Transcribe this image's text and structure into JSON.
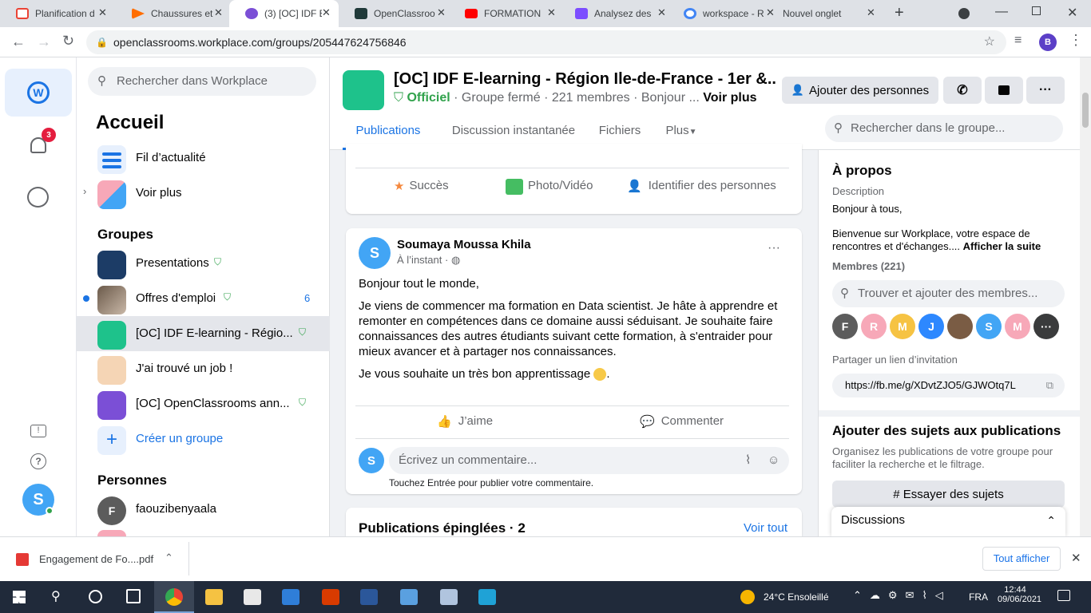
{
  "browser": {
    "tabs": [
      {
        "title": "Planification d",
        "color": "#ea4335"
      },
      {
        "title": "Chaussures et",
        "color": "#ff6d00"
      },
      {
        "title": "(3) [OC] IDF E",
        "color": "#7b4fd6"
      },
      {
        "title": "OpenClassroo",
        "color": "#203a3a"
      },
      {
        "title": "FORMATION",
        "color": "#ff0000"
      },
      {
        "title": "Analysez des",
        "color": "#7c4dff"
      },
      {
        "title": "workspace - R",
        "color": "#4285f4"
      },
      {
        "title": "Nouvel onglet",
        "color": ""
      }
    ],
    "url": "openclassrooms.workplace.com/groups/205447624756846",
    "profile_initial": "B"
  },
  "rail": {
    "notif_count": "3",
    "user_initial": "S"
  },
  "nav": {
    "search_placeholder": "Rechercher dans Workplace",
    "heading": "Accueil",
    "feed": "Fil d’actualité",
    "more": "Voir plus",
    "groups_title": "Groupes",
    "groups": [
      {
        "label": "Presentations",
        "badge": ""
      },
      {
        "label": "Offres d'emploi",
        "badge": "6"
      },
      {
        "label": "[OC] IDF E-learning - Régio...",
        "badge": ""
      },
      {
        "label": "J'ai trouvé un job !",
        "badge": ""
      },
      {
        "label": "[OC] OpenClassrooms ann...",
        "badge": ""
      }
    ],
    "create_group": "Créer un groupe",
    "people_title": "Personnes",
    "person1": "faouzibenyaala",
    "person1_initial": "F"
  },
  "group": {
    "title": "[OC] IDF E-learning - Région Ile-de-France - 1er &...",
    "official": "Officiel",
    "meta": "· Groupe fermé · 221 membres · Bonjour ...",
    "see_more": "Voir plus",
    "add_people": "Ajouter des personnes",
    "tabs": [
      "Publications",
      "Discussion instantanée",
      "Fichiers",
      "Plus"
    ],
    "search_placeholder": "Rechercher dans le groupe..."
  },
  "composer": {
    "success": "Succès",
    "photo": "Photo/Vidéo",
    "tag": "Identifier des personnes"
  },
  "post": {
    "author": "Soumaya Moussa Khila",
    "author_initial": "S",
    "time": "À l’instant ·",
    "p1": "Bonjour tout le monde,",
    "p2": "Je viens de commencer ma formation en Data scientist. Je hâte à apprendre et remonter en compétences dans ce domaine aussi séduisant. Je souhaite faire connaissances des autres étudiants suivant cette formation, à s'entraider pour mieux avancer et à partager nos connaissances.",
    "p3": "Je vous souhaite un très bon apprentissage",
    "p3_end": ".",
    "like": "J’aime",
    "comment": "Commenter",
    "comment_placeholder": "Écrivez un commentaire...",
    "hint": "Touchez Entrée pour publier votre commentaire."
  },
  "pinned": {
    "title": "Publications épinglées · 2",
    "see_all": "Voir tout"
  },
  "about": {
    "title": "À propos",
    "desc_label": "Description",
    "desc1": "Bonjour à tous,",
    "desc2": "Bienvenue sur Workplace, votre espace de rencontres et d'échanges....",
    "read_more": "Afficher la suite",
    "members": "Membres (221)",
    "find_placeholder": "Trouver et ajouter des membres...",
    "member_initials": [
      "F",
      "R",
      "M",
      "J",
      "",
      "S",
      "M",
      "···"
    ],
    "member_colors": [
      "#5c5c5c",
      "#f7a8b8",
      "#f6c343",
      "#2d88ff",
      "#7a5c44",
      "#42a5f5",
      "#f7a8b8",
      "#3a3b3c"
    ],
    "share_label": "Partager un lien d’invitation",
    "link": "https://fb.me/g/XDvtZJO5/GJWOtq7L"
  },
  "topics": {
    "title": "Ajouter des sujets aux publications",
    "desc": "Organisez les publications de votre groupe pour faciliter la recherche et le filtrage.",
    "button": "# Essayer des sujets",
    "discussions": "Discussions"
  },
  "download": {
    "file": "Engagement de Fo....pdf",
    "show_all": "Tout afficher"
  },
  "taskbar": {
    "weather": "24°C  Ensoleillé",
    "lang": "FRA",
    "time": "12:44",
    "date": "09/06/2021"
  }
}
